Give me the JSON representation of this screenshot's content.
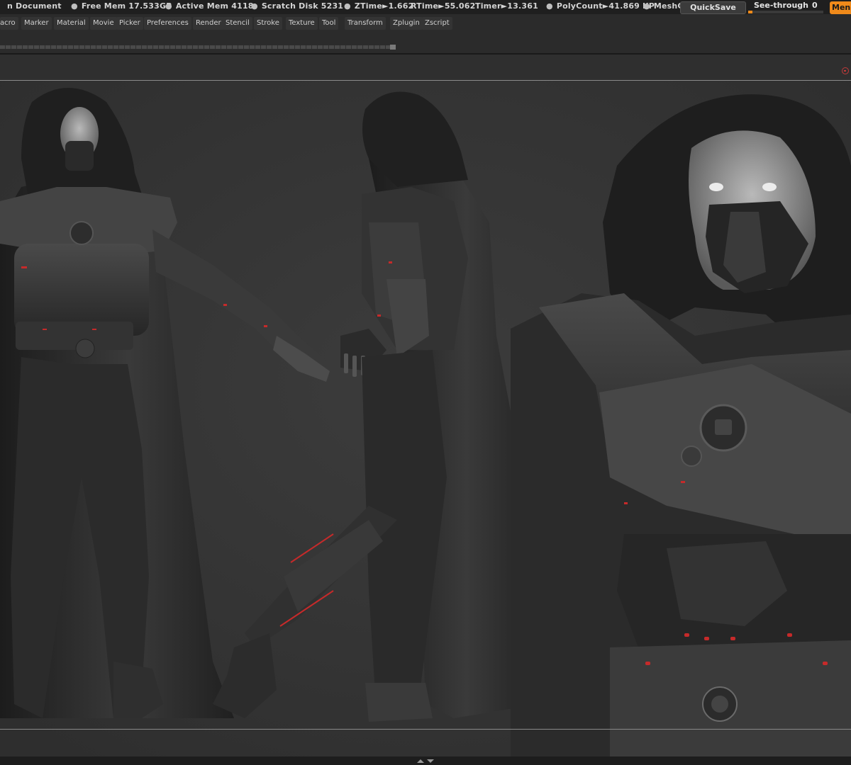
{
  "status": {
    "document": "n Document",
    "free_mem": "Free Mem 17.533GB",
    "active_mem": "Active Mem 4118",
    "scratch_disk": "Scratch Disk 5231",
    "ztime": "ZTime►1.662",
    "rtime": "RTime►55.062",
    "timer": "Timer►13.361",
    "polycount": "PolyCount►41.869 KP",
    "meshc": "MeshCo"
  },
  "toolbar": {
    "quicksave": "QuickSave",
    "seethrough_label": "See-through",
    "seethrough_value": "0",
    "seethrough_level": 0.0,
    "menus": "Menus"
  },
  "menu": {
    "items": [
      "acro",
      "Marker",
      "Material",
      "Movie",
      "Picker",
      "Preferences",
      "Render",
      "Stencil",
      "Stroke",
      "Texture",
      "Tool",
      "Transform",
      "Zplugin",
      "Zscript"
    ]
  },
  "colors": {
    "accent": "#f08a1a",
    "close": "#c23a3a",
    "background": "#353535"
  },
  "icons": {
    "close": "close-icon",
    "collapse": "chevron-handle-icon"
  }
}
